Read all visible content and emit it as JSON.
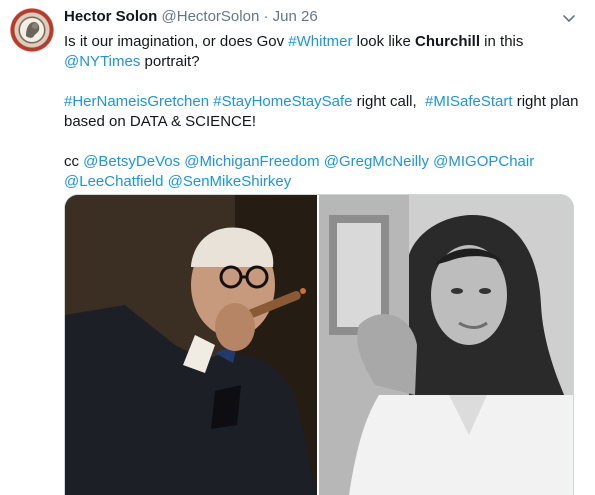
{
  "tweet": {
    "name": "Hector Solon",
    "handle": "@HectorSolon",
    "separator": "·",
    "date": "Jun 26",
    "line1": {
      "pre": "Is it our imagination, or does Gov ",
      "tag_whitmer": "#Whitmer",
      "mid": " look like ",
      "churchill": "Churchill",
      "post": " in this"
    },
    "line2": {
      "mention_nyt": "@NYTimes",
      "post": " portrait?"
    },
    "line3": {
      "tag1": "#HerNameisGretchen",
      "tag2": "#StayHomeStaySafe",
      "mid": " right call,  ",
      "tag3": "#MISafeStart",
      "post": " right plan"
    },
    "line4": "based on DATA & SCIENCE!",
    "line5": {
      "pre": "cc ",
      "m1": "@BetsyDeVos",
      "m2": "@MichiganFreedom",
      "m3": "@GregMcNeilly",
      "m4": "@MIGOPChair"
    },
    "line6": {
      "m5": "@LeeChatfield",
      "m6": "@SenMikeShirkey"
    }
  },
  "icons": {
    "menu": "chevron-down-icon",
    "avatar": "avatar-icon"
  },
  "colors": {
    "link": "#1b95e0",
    "muted": "#657786",
    "text": "#14171a",
    "border": "#ccd6dd"
  }
}
